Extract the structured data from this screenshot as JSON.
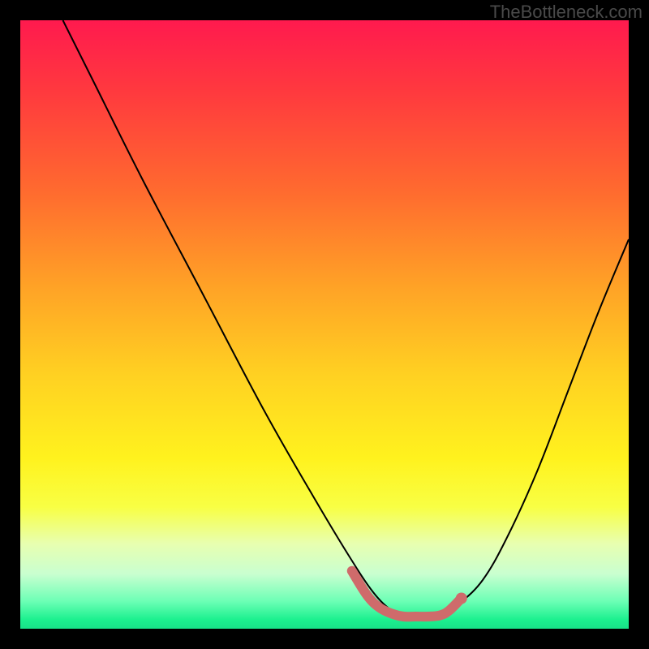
{
  "watermark": "TheBottleneck.com",
  "colors": {
    "frame": "#000000",
    "watermark": "#4a4a4a",
    "curve_stroke": "#000000",
    "highlight_stroke": "#cf6b6b",
    "gradient_stops": [
      {
        "offset": 0.0,
        "color": "#ff1a4e"
      },
      {
        "offset": 0.12,
        "color": "#ff3a3e"
      },
      {
        "offset": 0.28,
        "color": "#ff6a2f"
      },
      {
        "offset": 0.44,
        "color": "#ffa326"
      },
      {
        "offset": 0.58,
        "color": "#ffd022"
      },
      {
        "offset": 0.72,
        "color": "#fff21e"
      },
      {
        "offset": 0.8,
        "color": "#f8ff44"
      },
      {
        "offset": 0.86,
        "color": "#e8ffb0"
      },
      {
        "offset": 0.91,
        "color": "#c9ffd0"
      },
      {
        "offset": 0.955,
        "color": "#6cffb5"
      },
      {
        "offset": 0.985,
        "color": "#1cf08f"
      },
      {
        "offset": 1.0,
        "color": "#18e288"
      }
    ]
  },
  "chart_data": {
    "type": "line",
    "title": "",
    "xlabel": "",
    "ylabel": "",
    "xlim": [
      0,
      100
    ],
    "ylim": [
      0,
      100
    ],
    "series": [
      {
        "name": "bottleneck-curve",
        "x": [
          7,
          12,
          20,
          30,
          40,
          48,
          54,
          58,
          61,
          63,
          66,
          69,
          72,
          76,
          80,
          85,
          90,
          95,
          100
        ],
        "y": [
          100,
          90,
          74,
          55,
          36,
          22,
          12,
          6,
          3,
          2,
          2,
          2,
          4,
          8,
          15,
          26,
          39,
          52,
          64
        ]
      }
    ],
    "highlight": {
      "name": "optimal-zone",
      "x": [
        54.5,
        57,
        59,
        61,
        63,
        65,
        67,
        69,
        70.5,
        72.5
      ],
      "y": [
        9.5,
        5.5,
        3.5,
        2.5,
        2.0,
        2.0,
        2.0,
        2.2,
        3.0,
        5.0
      ]
    }
  }
}
